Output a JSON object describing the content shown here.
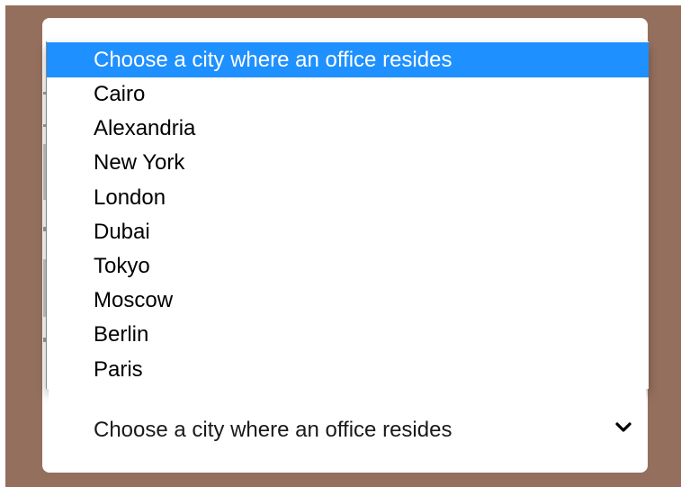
{
  "select": {
    "selected_label": "Choose a city where an office resides",
    "options": [
      "Choose a city where an office resides",
      "Cairo",
      "Alexandria",
      "New York",
      "London",
      "Dubai",
      "Tokyo",
      "Moscow",
      "Berlin",
      "Paris"
    ],
    "highlighted_index": 0,
    "expanded": true
  },
  "colors": {
    "background_frame": "#946f5d",
    "highlight": "#1e90ff",
    "card": "#ffffff"
  },
  "icons": {
    "select_arrow": "chevron-down-icon"
  }
}
